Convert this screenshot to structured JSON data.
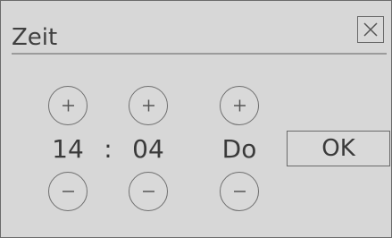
{
  "dialog": {
    "title": "Zeit",
    "ok_label": "OK"
  },
  "time": {
    "hour": "14",
    "separator": ":",
    "minute": "04",
    "day": "Do"
  },
  "icons": {
    "close": "close-icon",
    "plus": "plus-icon",
    "minus": "minus-icon"
  }
}
